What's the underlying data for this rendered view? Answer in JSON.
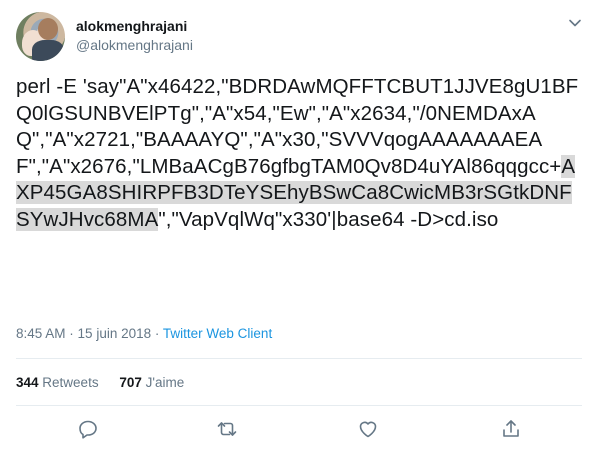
{
  "user": {
    "name": "alokmenghrajani",
    "handle": "@alokmenghrajani"
  },
  "tweet": {
    "text_before": "perl -E 'say\"A\"x46422,\"BDRDAwMQFFTCBUT1JJVE8gU1BFQ0lGSUNBVElPTg\",\"A\"x54,\"Ew\",\"A\"x2634,\"/0NEMDAxAQ\",\"A\"x2721,\"BAAAAYQ\",\"A\"x30,\"SVVVqogAAAAAAAEAF\",\"A\"x2676,\"LMBaACgB76gfbgTAM0Qv8D4uYAl86qqgcc+",
    "text_highlight": "AXP45GA8SHIRPFB3DTeYSEhyBSwCa8CwicMB3rSGtkDNFSYwJHvc68MA",
    "text_after": "\",\"VapVqlWq\"x330'|base64 -D>cd.iso"
  },
  "meta": {
    "time": "8:45 AM",
    "date": "15 juin 2018",
    "separator": "·",
    "client": "Twitter Web Client"
  },
  "stats": {
    "retweets_count": "344",
    "retweets_label": "Retweets",
    "likes_count": "707",
    "likes_label": "J'aime"
  },
  "icons": {
    "caret": "chevron-down-icon",
    "reply": "reply-icon",
    "retweet": "retweet-icon",
    "like": "heart-icon",
    "share": "share-icon"
  },
  "colors": {
    "text": "#14171a",
    "secondary": "#657786",
    "link": "#1b95e0",
    "highlight": "#d9d9d9",
    "divider": "#e6ecf0"
  }
}
